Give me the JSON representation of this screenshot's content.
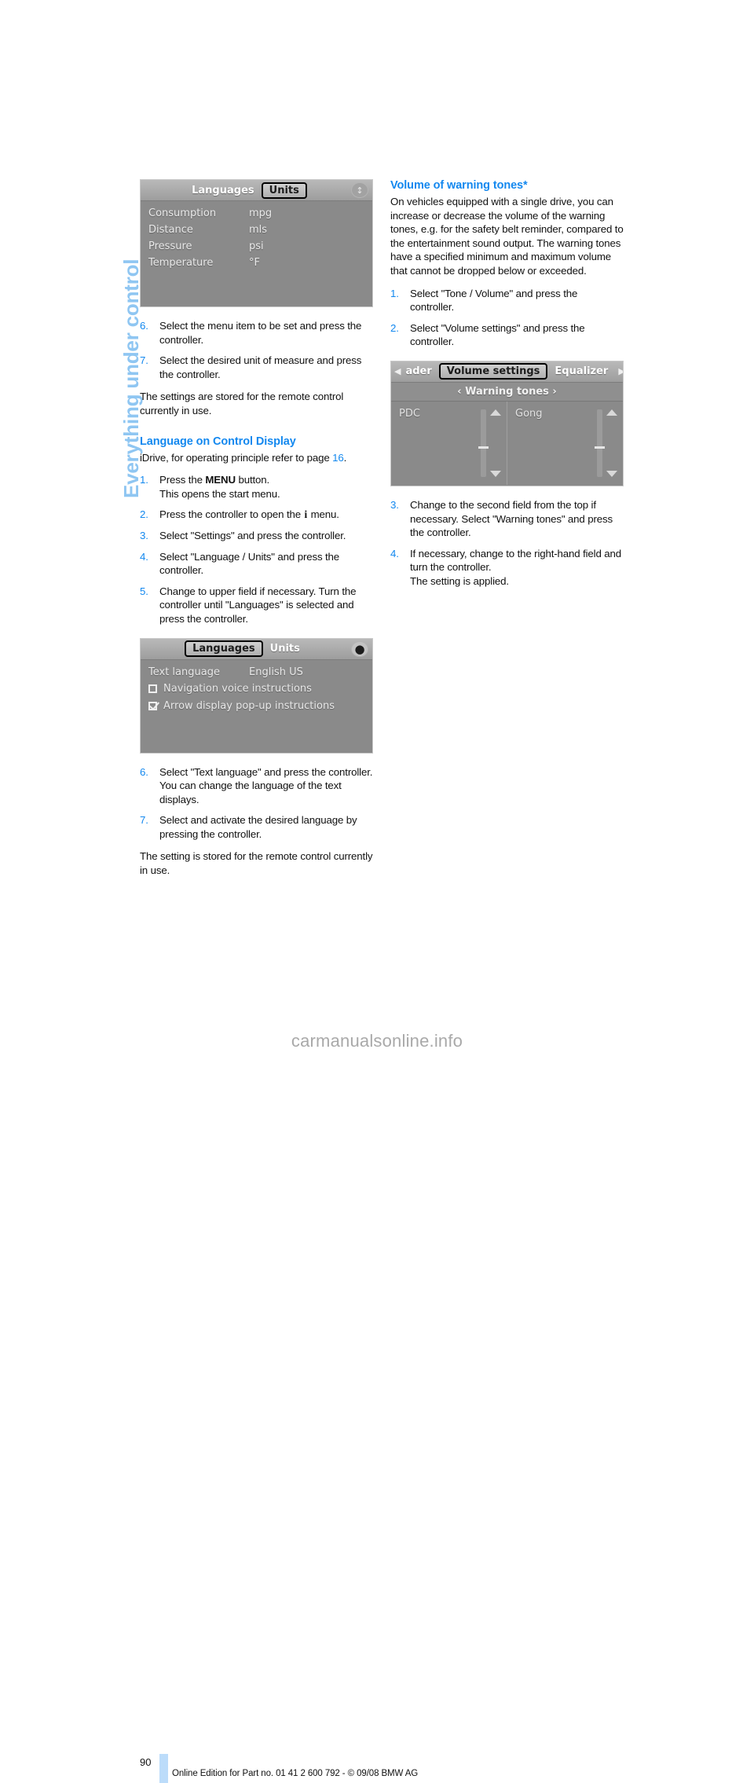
{
  "chapter_tab": {
    "label": "Everything under control"
  },
  "left_column": {
    "figure_units": {
      "tabs": [
        {
          "label": "Languages",
          "selected": false
        },
        {
          "label": "Units",
          "selected": true
        }
      ],
      "corner_icon": "updown-arrows-icon",
      "rows": [
        {
          "label": "Consumption",
          "value": "mpg"
        },
        {
          "label": "Distance",
          "value": "mls"
        },
        {
          "label": "Pressure",
          "value": "psi"
        },
        {
          "label": "Temperature",
          "value": "°F"
        }
      ]
    },
    "steps_units": [
      {
        "num": "6.",
        "text": "Select the menu item to be set and press the controller."
      },
      {
        "num": "7.",
        "text": "Select the desired unit of measure and press the controller."
      }
    ],
    "note_units": "The settings are stored for the remote control currently in use.",
    "heading": "Language on Control Display",
    "intro_prefix": "iDrive, for operating principle refer to page ",
    "intro_page_ref": "16",
    "intro_suffix": ".",
    "steps_language": [
      {
        "num": "1.",
        "pre": "Press the ",
        "bold": "MENU",
        "post": " button.",
        "line2": "This opens the start menu."
      },
      {
        "num": "2.",
        "pre": "Press the controller to open the ",
        "bold": "i",
        "post": " menu.",
        "line2": ""
      },
      {
        "num": "3.",
        "pre": "Select \"Settings\" and press the controller.",
        "bold": "",
        "post": "",
        "line2": ""
      },
      {
        "num": "4.",
        "pre": "Select \"Language / Units\" and press the controller.",
        "bold": "",
        "post": "",
        "line2": ""
      },
      {
        "num": "5.",
        "pre": "Change to upper field if necessary. Turn the controller until \"Languages\" is selected and press the controller.",
        "bold": "",
        "post": "",
        "line2": ""
      }
    ],
    "figure_languages": {
      "tabs": [
        {
          "label": "Languages",
          "selected": true
        },
        {
          "label": "Units",
          "selected": false
        }
      ],
      "corner_icon": "dot-diamond-icon",
      "row": {
        "label": "Text language",
        "value": "English US"
      },
      "checkboxes": [
        {
          "label": "Navigation voice instructions",
          "checked": false
        },
        {
          "label": "Arrow display pop-up instructions",
          "checked": true
        }
      ]
    },
    "steps_language2": [
      {
        "num": "6.",
        "text": "Select \"Text language\" and press the controller. You can change the language of the text displays."
      },
      {
        "num": "7.",
        "text": "Select and activate the desired language by pressing the controller."
      }
    ],
    "note_language": "The setting is stored for the remote control currently in use."
  },
  "right_column": {
    "heading": "Volume of warning tones*",
    "body": "On vehicles equipped with a single drive, you can increase or decrease the volume of the warning tones, e.g. for the safety belt reminder, compared to the entertainment sound output. The warning tones have a specified minimum and maximum volume that cannot be dropped below or exceeded.",
    "steps_a": [
      {
        "num": "1.",
        "text": "Select \"Tone / Volume\" and press the controller."
      },
      {
        "num": "2.",
        "text": "Select \"Volume settings\" and press the controller."
      }
    ],
    "figure_volume": {
      "left_arrow": "left-triangle-icon",
      "right_arrow": "right-triangle-icon",
      "corner_icon": "updown-arrows-icon",
      "tabs": [
        {
          "label": "ader",
          "selected": false
        },
        {
          "label": "Volume settings",
          "selected": true
        },
        {
          "label": "Equalizer",
          "selected": false
        }
      ],
      "subbar": "‹ Warning tones ›",
      "panels": [
        {
          "label": "PDC"
        },
        {
          "label": "Gong"
        }
      ]
    },
    "steps_b": [
      {
        "num": "3.",
        "text": "Change to the second field from the top if necessary. Select \"Warning tones\" and press the controller."
      },
      {
        "num": "4.",
        "text": "If necessary, change to the right-hand field and turn the controller.",
        "line2": "The setting is applied."
      }
    ]
  },
  "footer": {
    "page_number": "90",
    "text": "Online Edition for Part no. 01 41 2 600 792 - © 09/08 BMW AG"
  },
  "watermark": {
    "text": "carmanualsonline.info"
  },
  "colors": {
    "accent_blue": "#1388ef",
    "tab_blue": "#8fc6f2",
    "footer_bar_blue": "#bcdcfa",
    "screen_gray": "#8a8a8a"
  }
}
